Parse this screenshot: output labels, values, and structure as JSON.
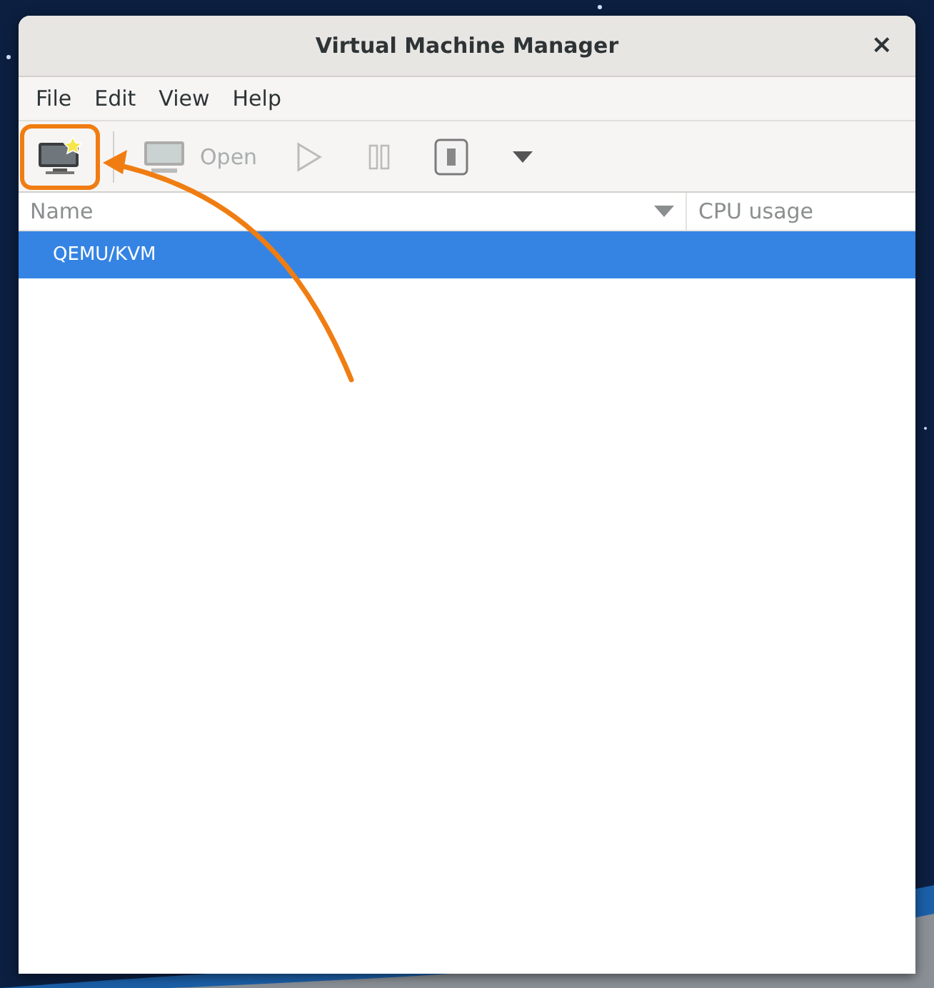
{
  "window": {
    "title": "Virtual Machine Manager",
    "close_glyph": "×"
  },
  "menu": [
    "File",
    "Edit",
    "View",
    "Help"
  ],
  "toolbar": [
    {
      "kind": "new",
      "disabled": false,
      "highlighted": true
    },
    {
      "kind": "open",
      "label": "Open",
      "disabled": true,
      "highlighted": false
    },
    {
      "kind": "run",
      "disabled": true,
      "highlighted": false
    },
    {
      "kind": "pause",
      "disabled": true,
      "highlighted": false
    },
    {
      "kind": "shutdown",
      "disabled": false,
      "highlighted": false
    },
    {
      "kind": "menu",
      "disabled": false,
      "highlighted": false
    }
  ],
  "columns": [
    {
      "label": "Name",
      "sorted": true
    },
    {
      "label": "CPU usage",
      "sorted": false
    }
  ],
  "rows": [
    {
      "name": "QEMU/KVM",
      "selected": true
    }
  ],
  "annotation_arrow": true
}
